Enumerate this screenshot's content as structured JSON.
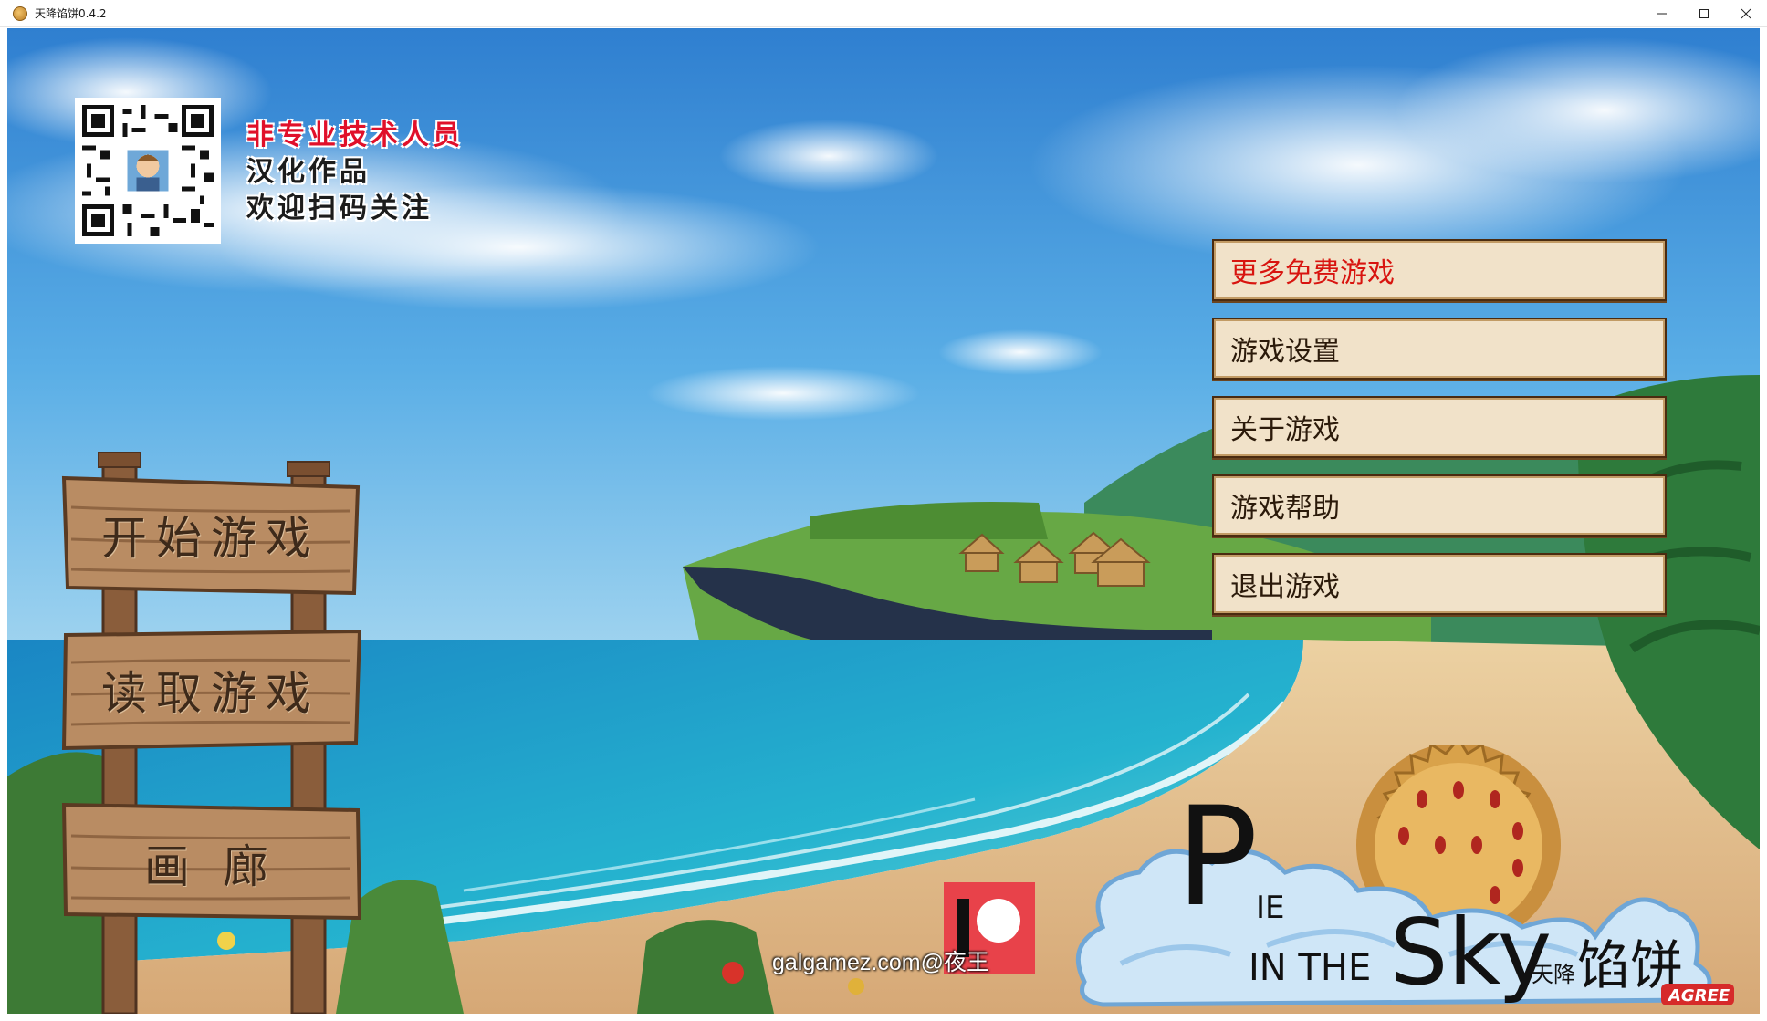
{
  "window": {
    "title": "天降馅饼0.4.2",
    "controls": {
      "minimize": "—",
      "maximize": "☐",
      "close": "✕"
    }
  },
  "credits": {
    "line1": "非专业技术人员",
    "line2": "汉化作品",
    "line3": "欢迎扫码关注"
  },
  "menu": {
    "items": [
      {
        "label": "更多免费游戏",
        "color": "#d8140f"
      },
      {
        "label": "游戏设置"
      },
      {
        "label": "关于游戏"
      },
      {
        "label": "游戏帮助"
      },
      {
        "label": "退出游戏"
      }
    ]
  },
  "signs": {
    "start": "开始游戏",
    "load": "读取游戏",
    "gallery": "画 廊"
  },
  "watermark": "galgamez.com@夜王",
  "logo": {
    "p": "P",
    "ie": "IE",
    "in_the": "IN THE",
    "sky": "Sky",
    "cn_small": "天降",
    "cn_big": "馅饼",
    "badge": "AGREE"
  },
  "colors": {
    "sky": "#4a9edb",
    "sea": "#1a9fc8",
    "sand": "#e6c48f",
    "menu_bg": "#f1e2c9",
    "menu_border": "#4a2b10",
    "wood": "#b88a62",
    "accent_red": "#e0102a"
  }
}
